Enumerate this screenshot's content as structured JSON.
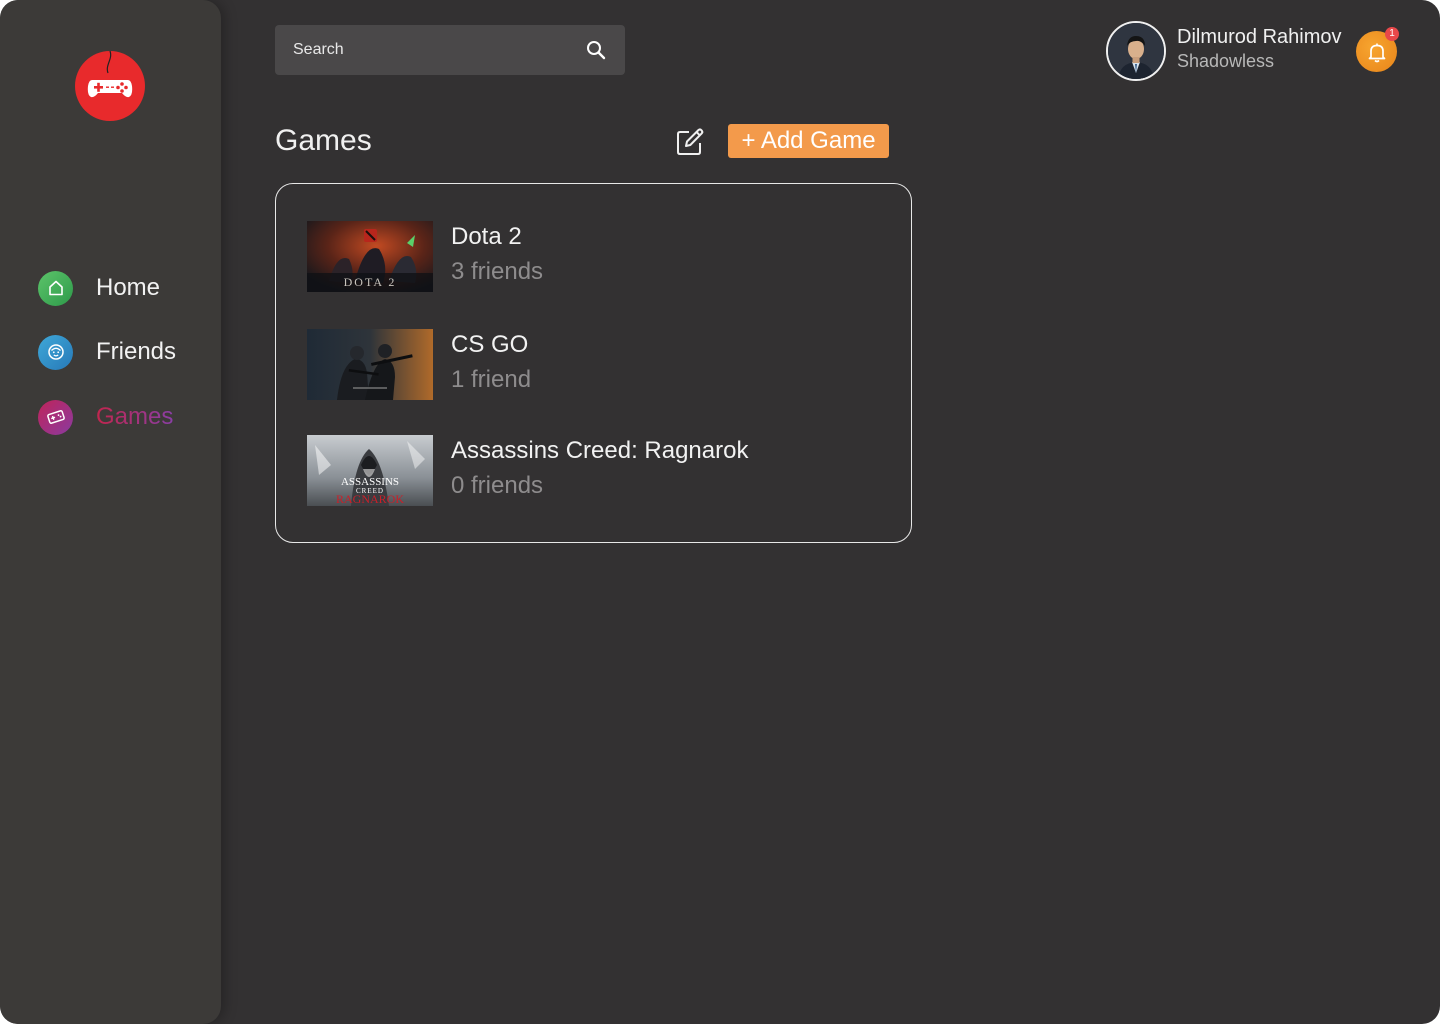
{
  "search": {
    "placeholder": "Search"
  },
  "user": {
    "name": "Dilmurod Rahimov",
    "handle": "Shadowless",
    "notification_count": "1"
  },
  "sidebar": {
    "items": [
      {
        "label": "Home",
        "icon": "home-icon"
      },
      {
        "label": "Friends",
        "icon": "face-icon"
      },
      {
        "label": "Games",
        "icon": "ticket-icon",
        "active": true
      }
    ]
  },
  "main": {
    "title": "Games",
    "add_label": "+ Add Game"
  },
  "games": [
    {
      "name": "Dota 2",
      "friends": "3 friends",
      "thumb_text": "DOTA 2"
    },
    {
      "name": "CS GO",
      "friends": "1 friend"
    },
    {
      "name": "Assassins Creed: Ragnarok",
      "friends": "0 friends",
      "thumb_text_1": "ASSASSINS",
      "thumb_text_2": "CREED",
      "thumb_text_3": "RAGNAROK"
    }
  ],
  "colors": {
    "background": "#333132",
    "sidebar": "#3c3a38",
    "accent": "#f39a4b",
    "logo": "#e82a2c",
    "active_nav": "#c2254d"
  }
}
